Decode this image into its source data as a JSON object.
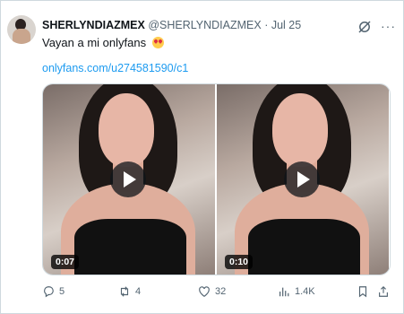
{
  "tweet": {
    "display_name": "SHERLYNDIAZMEX",
    "handle": "@SHERLYNDIAZMEX",
    "separator": "·",
    "date": "Jul 25",
    "text": "Vayan a mi onlyfans",
    "emoji": "heart-eyes-emoji",
    "link": "onlyfans.com/u274581590/c1"
  },
  "media": [
    {
      "duration": "0:07"
    },
    {
      "duration": "0:10"
    }
  ],
  "actions": {
    "replies": "5",
    "reposts": "4",
    "likes": "32",
    "views": "1.4K"
  },
  "icons": [
    "grok-icon",
    "more-icon",
    "reply-icon",
    "repost-icon",
    "like-icon",
    "views-icon",
    "bookmark-icon",
    "share-icon",
    "play-icon"
  ],
  "colors": {
    "link": "#1d9bf0",
    "muted": "#536471",
    "border": "#cfd9de"
  }
}
